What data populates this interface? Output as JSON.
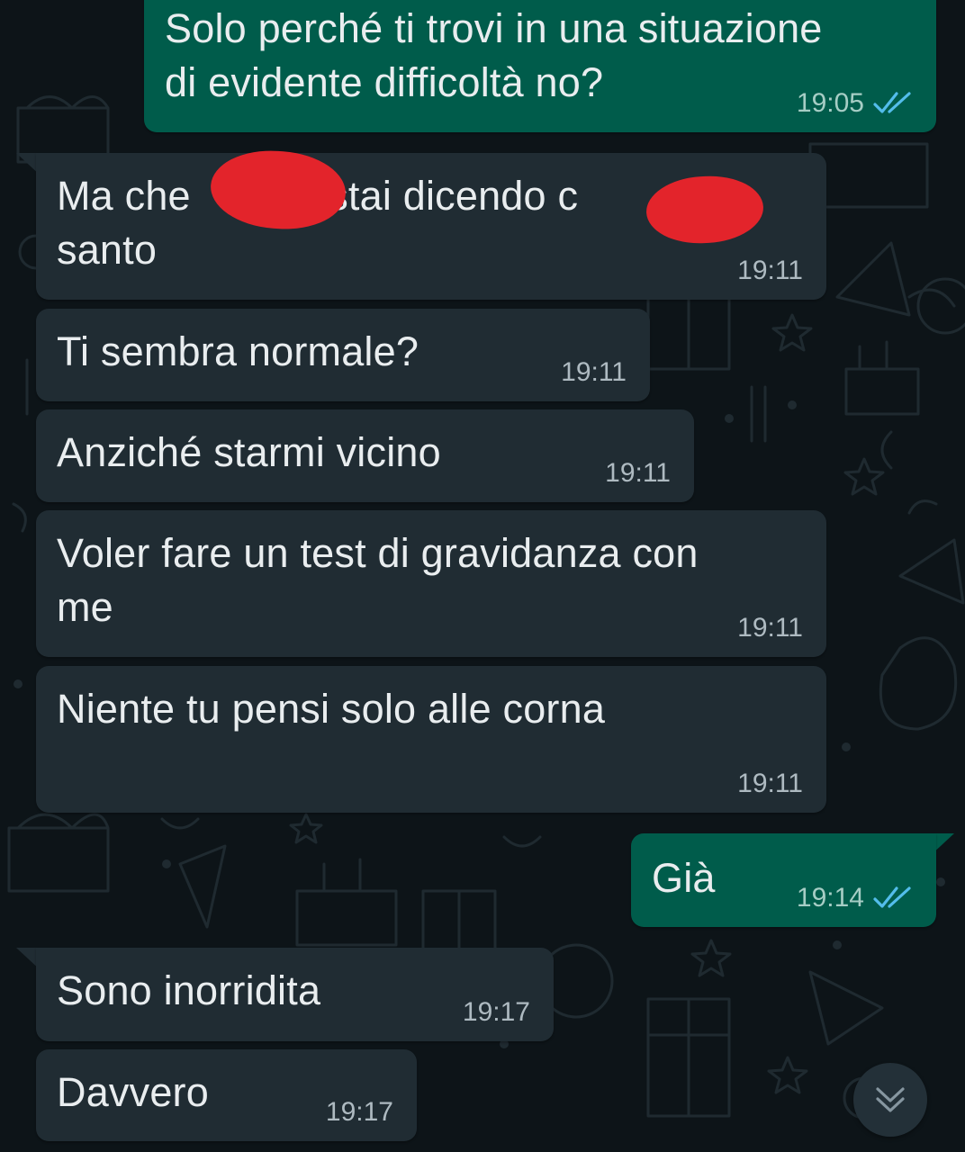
{
  "messages": [
    {
      "direction": "out",
      "text": "Solo perché ti trovi in una situazione\ndi evidente difficoltà no?",
      "time": "19:05",
      "status": "read"
    },
    {
      "direction": "in",
      "text": "Ma che            stai dicendo c\nsanto",
      "time": "19:11",
      "redacted": true
    },
    {
      "direction": "in",
      "text": "Ti sembra normale?",
      "time": "19:11"
    },
    {
      "direction": "in",
      "text": "Anziché starmi vicino",
      "time": "19:11"
    },
    {
      "direction": "in",
      "text": "Voler fare un test di gravidanza con\nme",
      "time": "19:11"
    },
    {
      "direction": "in",
      "text": "Niente tu pensi solo alle corna",
      "time": "19:11"
    },
    {
      "direction": "out",
      "text": "Già",
      "time": "19:14",
      "status": "read"
    },
    {
      "direction": "in",
      "text": "Sono inorridita",
      "time": "19:17"
    },
    {
      "direction": "in",
      "text": "Davvero",
      "time": "19:17"
    }
  ],
  "colors": {
    "incoming_bubble": "#202c33",
    "outgoing_bubble": "#005c4b",
    "read_check": "#53bdeb",
    "redaction": "#e3242b",
    "background": "#0d1418"
  },
  "icons": {
    "read_receipt": "double-check-icon",
    "scroll_down": "double-chevron-down-icon"
  }
}
